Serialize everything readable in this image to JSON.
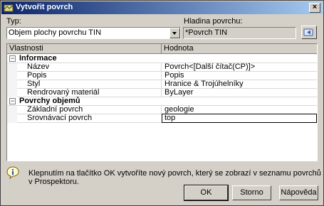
{
  "window": {
    "title": "Vytvořit povrch",
    "close_label": "×"
  },
  "type_label": "Typ:",
  "type_value": "Objem plochy povrchu TIN",
  "layer_label": "Hladina povrchu:",
  "layer_value": "*Povrch TIN",
  "grid": {
    "headers": [
      "Vlastnosti",
      "Hodnota"
    ],
    "categories": [
      {
        "label": "Informace",
        "expander": "−",
        "rows": [
          {
            "name": "Název",
            "value": "Povrch<[Další čítač(CP)]>"
          },
          {
            "name": "Popis",
            "value": "Popis"
          },
          {
            "name": "Styl",
            "value": "Hranice & Trojúhelníky"
          },
          {
            "name": "Rendrovaný materiál",
            "value": "ByLayer"
          }
        ]
      },
      {
        "label": "Povrchy objemů",
        "expander": "−",
        "rows": [
          {
            "name": "Základní povrch",
            "value": "geologie"
          },
          {
            "name": "Srovnávací povrch",
            "value": "top"
          }
        ]
      }
    ]
  },
  "info_text": "Klepnutím na tlačítko OK vytvoříte nový povrch, který se zobrazí v seznamu povrchů v Prospektoru.",
  "buttons": {
    "ok": "OK",
    "cancel": "Storno",
    "help": "Nápověda"
  }
}
